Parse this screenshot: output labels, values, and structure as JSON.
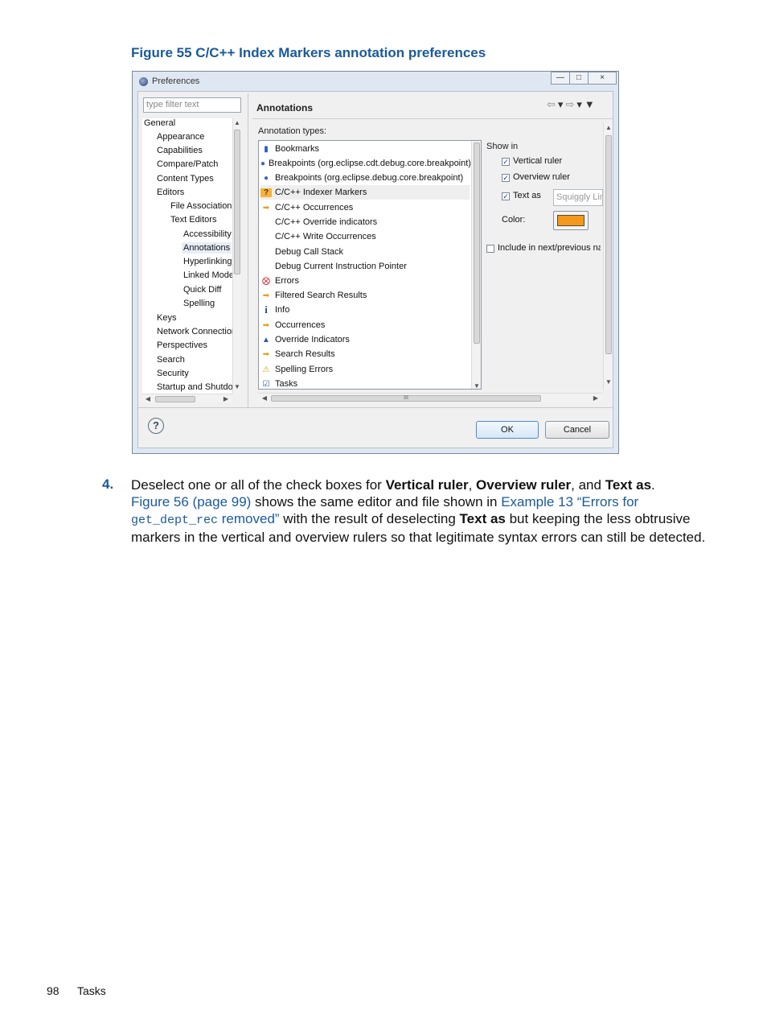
{
  "caption": "Figure 55 C/C++ Index Markers annotation preferences",
  "dialog": {
    "title": "Preferences",
    "filter_placeholder": "type filter text",
    "tree": [
      "General",
      "Appearance",
      "Capabilities",
      "Compare/Patch",
      "Content Types",
      "Editors",
      "File Associations",
      "Text Editors",
      "Accessibility",
      "Annotations",
      "Hyperlinking",
      "Linked Mode",
      "Quick Diff",
      "Spelling",
      "Keys",
      "Network Connections",
      "Perspectives",
      "Search",
      "Security",
      "Startup and Shutdown"
    ],
    "section_title": "Annotations",
    "annotation_types_label": "Annotation types:",
    "annotation_types": [
      "Bookmarks",
      "Breakpoints (org.eclipse.cdt.debug.core.breakpoint)",
      "Breakpoints (org.eclipse.debug.core.breakpoint)",
      "C/C++ Indexer Markers",
      "C/C++ Occurrences",
      "C/C++ Override indicators",
      "C/C++ Write Occurrences",
      "Debug Call Stack",
      "Debug Current Instruction Pointer",
      "Errors",
      "Filtered Search Results",
      "Info",
      "Occurrences",
      "Override Indicators",
      "Search Results",
      "Spelling Errors",
      "Tasks"
    ],
    "show_in_label": "Show in",
    "vertical_ruler_label": "Vertical ruler",
    "overview_ruler_label": "Overview ruler",
    "text_as_label": "Text as",
    "text_as_value": "Squiggly Line",
    "color_label": "Color:",
    "color_value": "#f3991c",
    "include_label": "Include in next/previous navigation",
    "ok_label": "OK",
    "cancel_label": "Cancel",
    "help_glyph": "?",
    "hscroll_glyph": "III"
  },
  "step": {
    "number": "4.",
    "t1": "Deselect one or all of the check boxes for ",
    "b1": "Vertical ruler",
    "t2": ", ",
    "b2": "Overview ruler",
    "t3": ", and ",
    "b3": "Text as",
    "t4": ".",
    "link1": "Figure 56 (page 99)",
    "t5": " shows the same editor and file shown in ",
    "link2a": "Example 13 “Errors for ",
    "link2_code": "get_dept_rec",
    "link2b": " removed”",
    "t6": " with the result of deselecting ",
    "b4": "Text as",
    "t7": " but keeping the less obtrusive markers in the vertical and overview rulers so that legitimate syntax errors can still be detected."
  },
  "footer": {
    "page_number": "98",
    "section": "Tasks"
  }
}
